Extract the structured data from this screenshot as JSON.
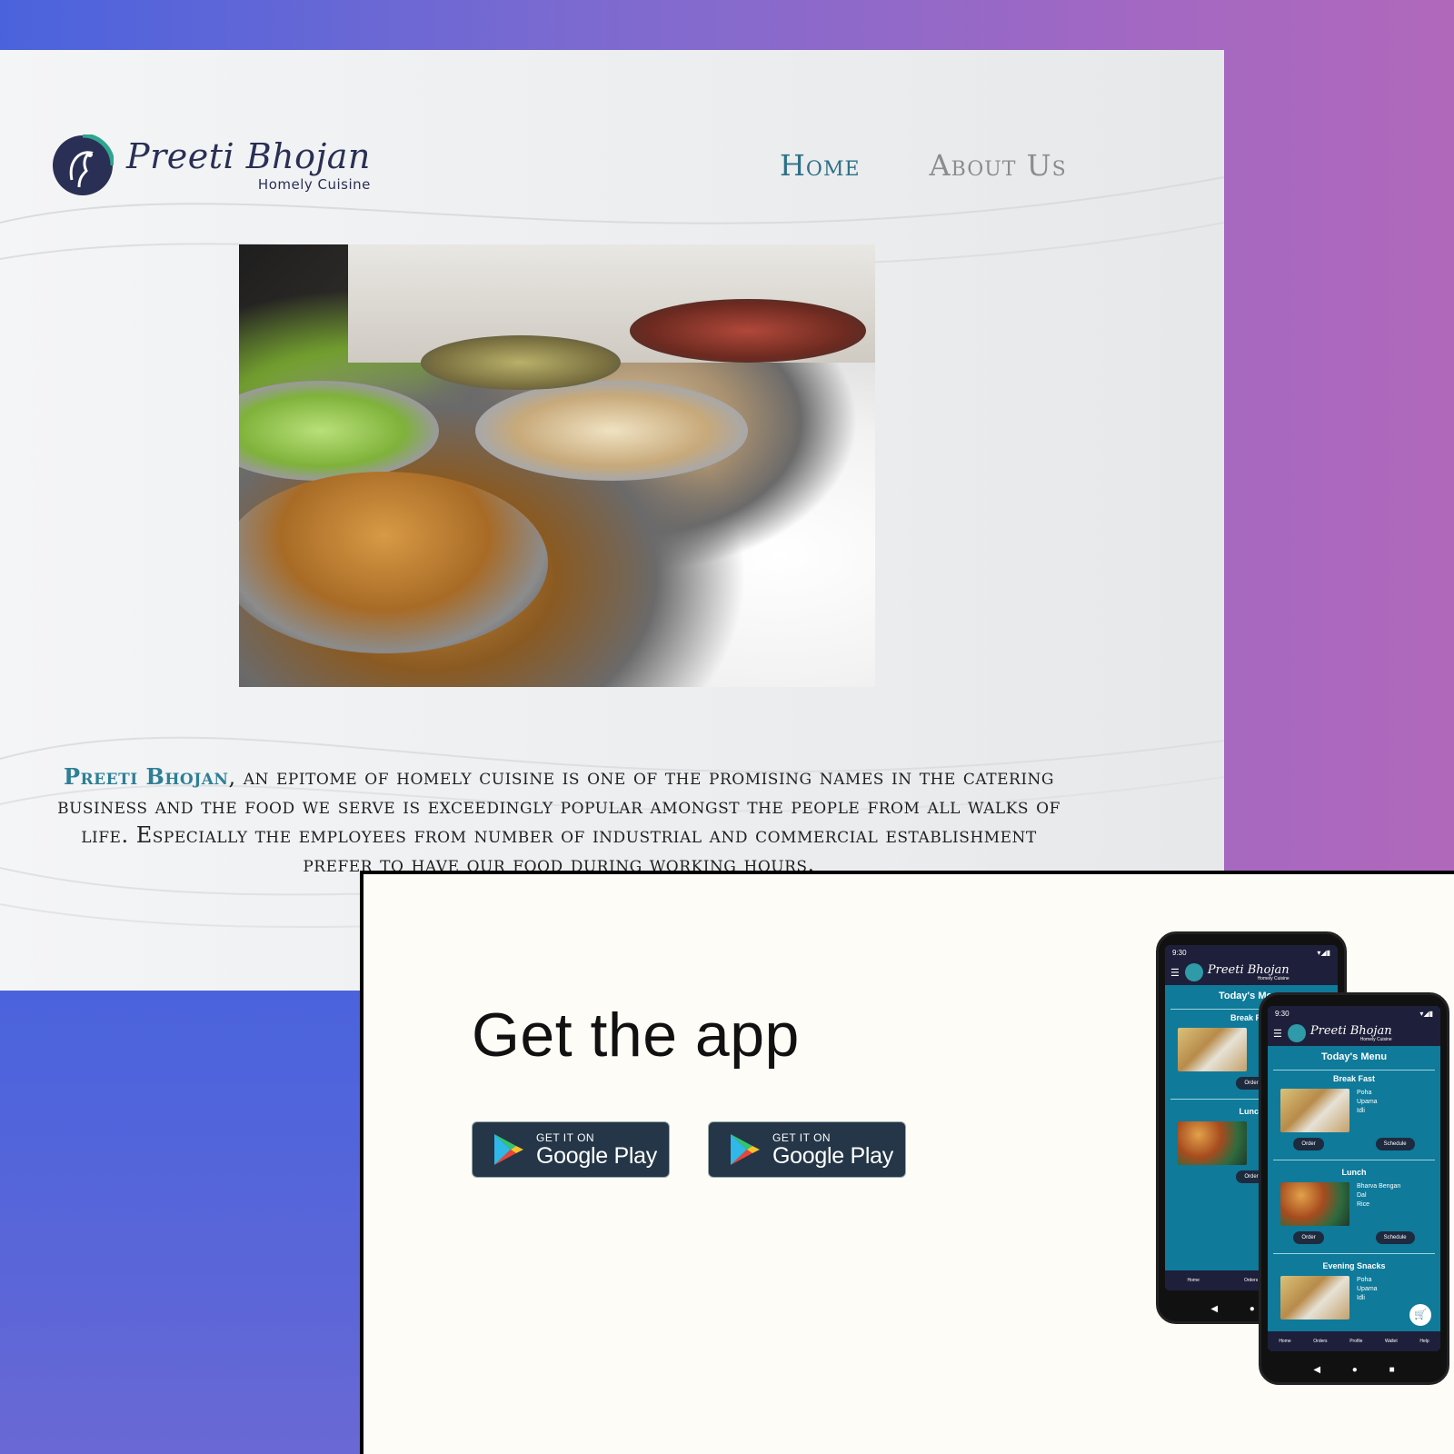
{
  "site": {
    "logo": {
      "name": "Preeti Bhojan",
      "tagline": "Homely Cuisine"
    },
    "nav": [
      {
        "label": "Home"
      },
      {
        "label": "About Us"
      }
    ],
    "hero_image_alt": "Catering buffet with chafing dishes",
    "description": {
      "brand": "Preeti Bhojan",
      "text": ", an epitome of homely cuisine is one of the promising names in the catering business and the food we serve is exceedingly popular amongst the people from all walks of life. Especially the employees from number of industrial and commercial establishment prefer to have our food during working hours."
    }
  },
  "app_section": {
    "title": "Get the app",
    "buttons": [
      {
        "small": "GET IT ON",
        "big": "Google Play"
      },
      {
        "small": "GET IT ON",
        "big": "Google Play"
      }
    ]
  },
  "phone": {
    "brand": "Preeti Bhojan",
    "brand_sub": "Homely Cuisine",
    "todays_menu": "Today's Menu",
    "sections": [
      {
        "title": "Break Fast",
        "items": [
          "Poha",
          "Upama",
          "Idli"
        ]
      },
      {
        "title": "Lunch",
        "items": [
          "Bharva Bengan",
          "Dal",
          "Rice"
        ]
      },
      {
        "title": "Evening Snacks",
        "items": [
          "Poha",
          "Upama",
          "Idli"
        ]
      }
    ],
    "order_label": "Order",
    "schedule_label": "Schedule",
    "bottom_nav": [
      "Home",
      "Orders",
      "Profile",
      "Wallet",
      "Help"
    ]
  },
  "colors": {
    "brand_teal": "#2e7f95",
    "navy": "#243647",
    "app_bg": "#0f7a9a"
  }
}
